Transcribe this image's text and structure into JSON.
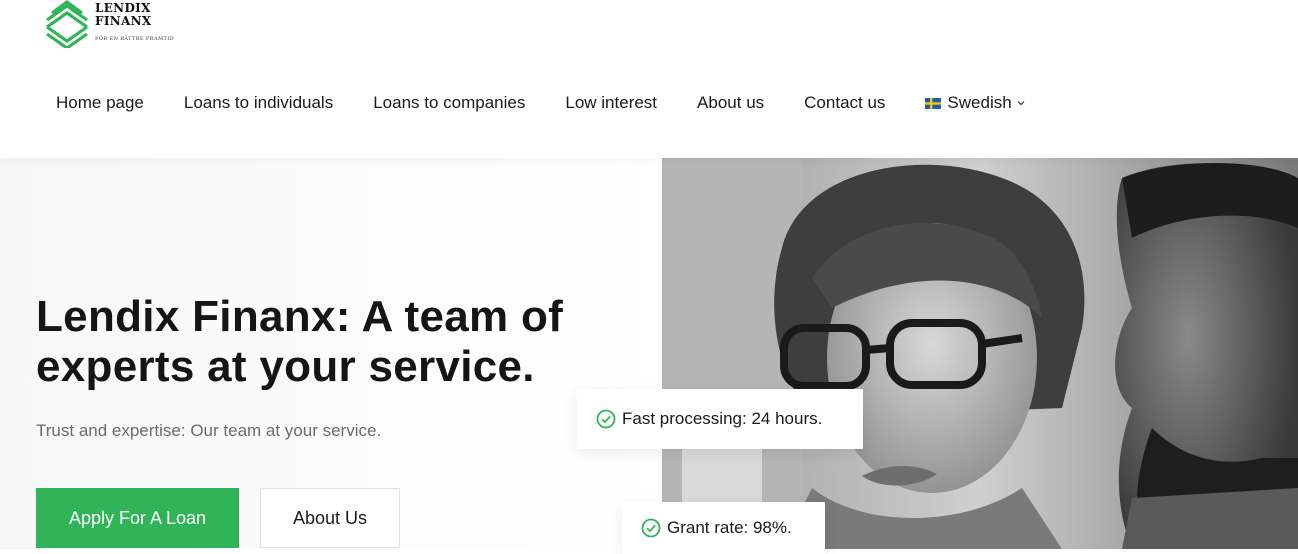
{
  "logo": {
    "name_line1": "LENDIX",
    "name_line2": "FINANX",
    "tagline": "FÖR EN BÄTTRE FRAMTID",
    "mark_icon": "layered-diamond-logo",
    "color": "#2fb457"
  },
  "nav": {
    "items": [
      {
        "label": "Home page"
      },
      {
        "label": "Loans to individuals"
      },
      {
        "label": "Loans to companies"
      },
      {
        "label": "Low interest"
      },
      {
        "label": "About us"
      },
      {
        "label": "Contact us"
      }
    ],
    "language": {
      "label": "Swedish",
      "flag_icon": "sweden-flag-icon",
      "chevron_icon": "chevron-down-icon"
    }
  },
  "hero": {
    "title_line1": "Lendix Finanx: A team of",
    "title_line2": "experts at your service.",
    "subtitle": "Trust and expertise: Our team at your service.",
    "apply_button": "Apply For A Loan",
    "about_button": "About Us",
    "badges": [
      {
        "text": "Fast processing: 24 hours.",
        "icon": "check-circle-icon"
      },
      {
        "text": "Grant rate: 98%.",
        "icon": "check-circle-icon"
      }
    ],
    "photo": "grayscale-team-photo"
  },
  "colors": {
    "accent": "#2fb457",
    "text": "#151515",
    "muted": "#6b6b6b"
  }
}
